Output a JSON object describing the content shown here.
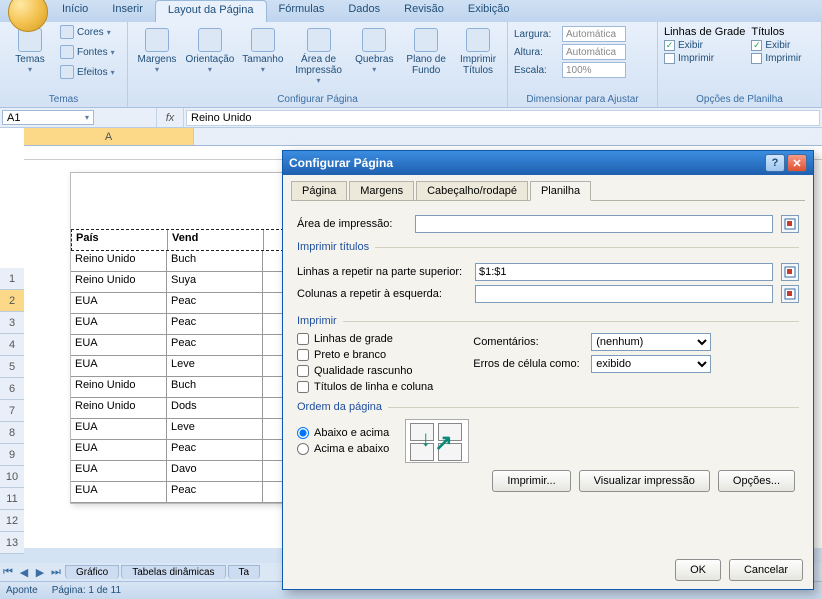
{
  "ribbon": {
    "tabs": [
      "Início",
      "Inserir",
      "Layout da Página",
      "Fórmulas",
      "Dados",
      "Revisão",
      "Exibição"
    ],
    "active_tab": 2,
    "group_temas": {
      "title": "Temas",
      "temas_btn": "Temas",
      "cores": "Cores",
      "fontes": "Fontes",
      "efeitos": "Efeitos"
    },
    "group_config": {
      "title": "Configurar Página",
      "margens": "Margens",
      "orientacao": "Orientação",
      "tamanho": "Tamanho",
      "area": "Área de Impressão",
      "quebras": "Quebras",
      "fundo": "Plano de Fundo",
      "titulos": "Imprimir Títulos"
    },
    "group_scale": {
      "title": "Dimensionar para Ajustar",
      "largura": "Largura:",
      "altura": "Altura:",
      "escala": "Escala:",
      "largura_val": "Automática",
      "altura_val": "Automática",
      "escala_val": "100%"
    },
    "group_sheet": {
      "title": "Opções de Planilha",
      "linhas_grade": "Linhas de Grade",
      "titulos": "Títulos",
      "exibir": "Exibir",
      "imprimir": "Imprimir"
    }
  },
  "formula": {
    "cell_ref": "A1",
    "fx": "fx",
    "value": "Reino Unido"
  },
  "sheet": {
    "col_label": "A",
    "row_numbers": [
      1,
      2,
      3,
      4,
      5,
      6,
      7,
      8,
      9,
      10,
      11,
      12,
      13
    ],
    "selected_row": 2,
    "headers": [
      "País",
      "Vend"
    ],
    "rows": [
      [
        "Reino Unido",
        "Buch"
      ],
      [
        "Reino Unido",
        "Suya"
      ],
      [
        "EUA",
        "Peac"
      ],
      [
        "EUA",
        "Peac"
      ],
      [
        "EUA",
        "Peac"
      ],
      [
        "EUA",
        "Leve"
      ],
      [
        "Reino Unido",
        "Buch"
      ],
      [
        "Reino Unido",
        "Dods"
      ],
      [
        "EUA",
        "Leve"
      ],
      [
        "EUA",
        "Peac"
      ],
      [
        "EUA",
        "Davo"
      ],
      [
        "EUA",
        "Peac"
      ]
    ],
    "tabs": [
      "Gráfico",
      "Tabelas dinâmicas",
      "Ta"
    ]
  },
  "status": {
    "aponte": "Aponte",
    "pagina": "Página: 1 de 11"
  },
  "dialog": {
    "title": "Configurar Página",
    "tabs": [
      "Página",
      "Margens",
      "Cabeçalho/rodapé",
      "Planilha"
    ],
    "active_tab": 3,
    "area_label": "Área de impressão:",
    "area_value": "",
    "legend_titulos": "Imprimir títulos",
    "linhas_label": "Linhas a repetir na parte superior:",
    "linhas_value": "$1:$1",
    "colunas_label": "Colunas a repetir à esquerda:",
    "colunas_value": "",
    "legend_imprimir": "Imprimir",
    "chk_grade": "Linhas de grade",
    "chk_pb": "Preto e branco",
    "chk_rascunho": "Qualidade rascunho",
    "chk_titulos": "Títulos de linha e coluna",
    "comentarios_label": "Comentários:",
    "comentarios_val": "(nenhum)",
    "erros_label": "Erros de célula como:",
    "erros_val": "exibido",
    "legend_ordem": "Ordem da página",
    "radio_abaixo": "Abaixo e acima",
    "radio_acima": "Acima e abaixo",
    "btn_imprimir": "Imprimir...",
    "btn_visualizar": "Visualizar impressão",
    "btn_opcoes": "Opções...",
    "btn_ok": "OK",
    "btn_cancelar": "Cancelar"
  }
}
